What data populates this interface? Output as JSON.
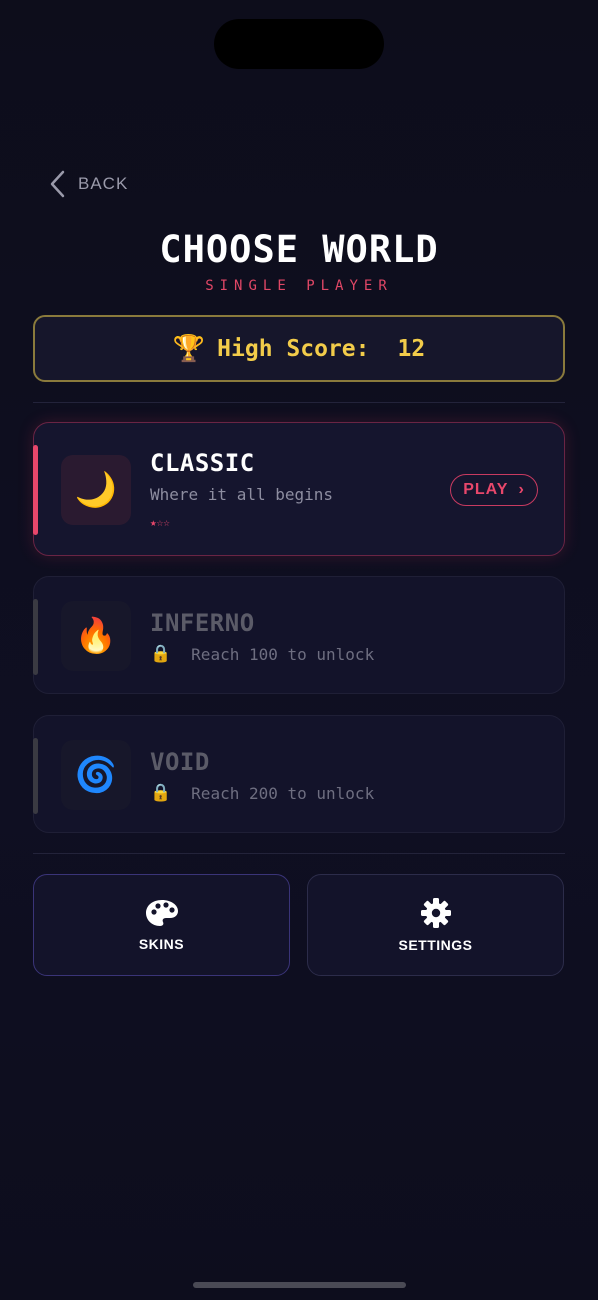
{
  "nav": {
    "back_label": "BACK"
  },
  "header": {
    "title": "CHOOSE WORLD",
    "subtitle": "SINGLE PLAYER"
  },
  "high_score": {
    "icon": "trophy-icon",
    "label": "High Score:",
    "value": "12"
  },
  "worlds": [
    {
      "name": "CLASSIC",
      "icon": "crescent-moon-icon",
      "glyph": "🌙",
      "description": "Where it all begins",
      "stars": "★☆☆",
      "stars_filled": 1,
      "stars_total": 3,
      "play_label": "PLAY",
      "play_chevron": "›",
      "accent_color": "#e8476b",
      "locked": false
    },
    {
      "name": "INFERNO",
      "icon": "fire-icon",
      "glyph": "🔥",
      "lock_glyph": "🔒",
      "lock_text": "Reach 100 to unlock",
      "locked": true
    },
    {
      "name": "VOID",
      "icon": "cyclone-icon",
      "glyph": "🌀",
      "lock_glyph": "🔒",
      "lock_text": "Reach 200 to unlock",
      "locked": true
    }
  ],
  "tiles": [
    {
      "label": "SKINS",
      "icon": "palette-icon",
      "border_color": "#3a3478"
    },
    {
      "label": "SETTINGS",
      "icon": "gear-icon",
      "border_color": "#2c2c4a"
    }
  ],
  "colors": {
    "background": "#0e0e20",
    "accent_red": "#e8476b",
    "gold": "#f2cc4a",
    "muted_text": "#8d8da0"
  }
}
